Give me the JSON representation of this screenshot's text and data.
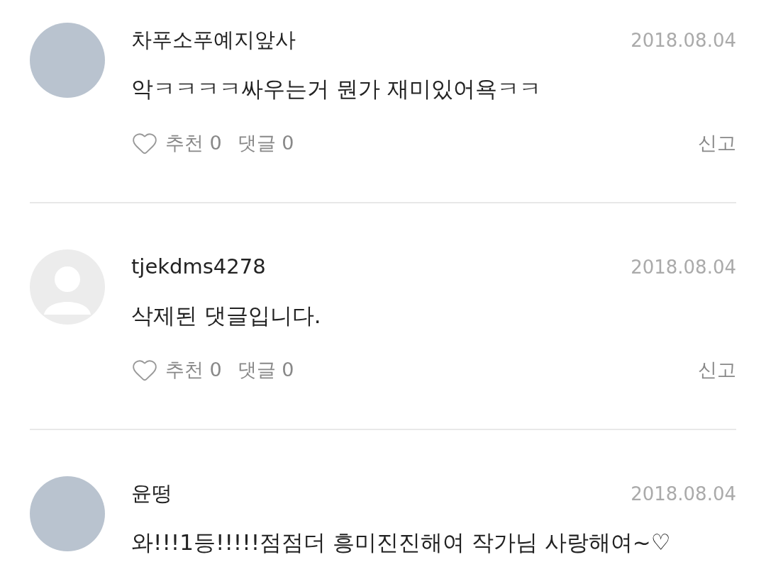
{
  "comments": [
    {
      "avatar": {
        "kind": "photo"
      },
      "username": "차푸소푸예지앞사",
      "date": "2018.08.04",
      "text": "악ㅋㅋㅋㅋ싸우는거 뭔가 재미있어욕ㅋㅋ",
      "actions": {
        "like": "추천 0",
        "reply": "댓글 0",
        "report": "신고"
      }
    },
    {
      "avatar": {
        "kind": "default"
      },
      "username": "tjekdms4278",
      "date": "2018.08.04",
      "text": "삭제된 댓글입니다.",
      "actions": {
        "like": "추천 0",
        "reply": "댓글 0",
        "report": "신고"
      }
    },
    {
      "avatar": {
        "kind": "photo"
      },
      "username": "윤떵",
      "date": "2018.08.04",
      "text": "와!!!1등!!!!!점점더 흥미진진해여 작가님 사랑해여~♡"
    }
  ]
}
